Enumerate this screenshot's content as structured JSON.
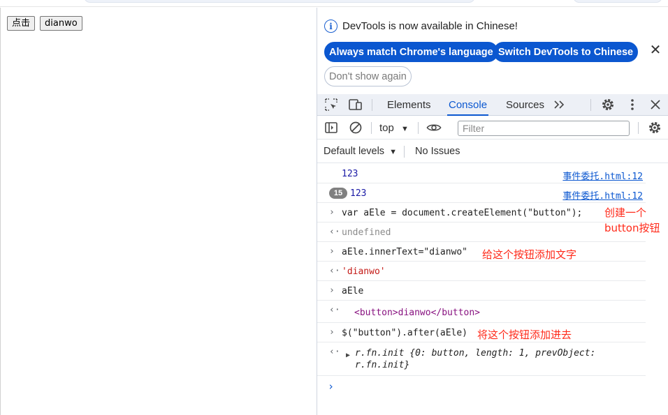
{
  "page": {
    "buttons": [
      "点击",
      "dianwo"
    ]
  },
  "devtools": {
    "infobar": {
      "message": "DevTools is now available in Chinese!",
      "match_button": "Always match Chrome's language",
      "switch_button": "Switch DevTools to Chinese",
      "dont_show_button": "Don't show again"
    },
    "tabs": {
      "elements": "Elements",
      "console": "Console",
      "sources": "Sources",
      "active": "Console"
    },
    "toolbar": {
      "context": "top",
      "filter_placeholder": "Filter"
    },
    "levels": {
      "default_levels": "Default levels",
      "issues": "No Issues"
    },
    "console": {
      "rows": [
        {
          "kind": "log",
          "text": "123",
          "source": "事件委托.html:12"
        },
        {
          "kind": "log",
          "count": "15",
          "text": "123",
          "source": "事件委托.html:12"
        },
        {
          "kind": "input",
          "text": "var aEle = document.createElement(\"button\");"
        },
        {
          "kind": "output",
          "text": "undefined"
        },
        {
          "kind": "input",
          "text": "aEle.innerText=\"dianwo\""
        },
        {
          "kind": "output",
          "text": "'dianwo'"
        },
        {
          "kind": "input",
          "text": "aEle"
        },
        {
          "kind": "output",
          "text": "<button>dianwo</button>"
        },
        {
          "kind": "input",
          "text": "$(\"button\").after(aEle)"
        },
        {
          "kind": "output",
          "text": "r.fn.init {0: button, length: 1, prevObject: r.fn.init}"
        }
      ],
      "annotations": {
        "create_line1": "创建一个",
        "create_line2": "button按钮",
        "add_text": "给这个按钮添加文字",
        "append": "将这个按钮添加进去"
      }
    }
  },
  "colors": {
    "accent": "#0b57d0",
    "annotation": "#ff2a1a",
    "string": "#c41a16",
    "number": "#1a1aa6"
  }
}
